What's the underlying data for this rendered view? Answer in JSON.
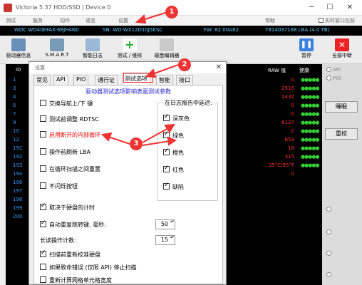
{
  "window": {
    "title": "Victoria 5.37 HDD/SSD | Device 0",
    "min": "─",
    "max": "☐",
    "close": "✕"
  },
  "menu": {
    "items": [
      "测试",
      "服务",
      "动作",
      "语言",
      "设置",
      "帮助"
    ],
    "realtime_label": "实时窗口在前"
  },
  "info": {
    "model": "WDC WD40EFAX-68JH4N0",
    "serial": "SN: WD-WX12D10J5KSC",
    "fw": "FW: 82.00A82",
    "lba": "7814037168 LBA (4.0 TB)"
  },
  "toolbar": {
    "drive_info": "驱动器信息",
    "smart": "S.M.A.R.T",
    "smart_log": "智能日志",
    "test_repair": "测试 / 维修",
    "disk_editor": "磁盘编辑器",
    "pause": "暂停",
    "stop": "全部中断"
  },
  "grid": {
    "col_id": "ID",
    "col_raw": "RAW 值",
    "col_health": "健康",
    "row_ids": [
      "1",
      "3",
      "4",
      "5",
      "7",
      "9",
      "10",
      "12",
      "191",
      "192",
      "193",
      "194",
      "196",
      "197",
      "198",
      "199",
      "200"
    ],
    "raw_values": [
      "0",
      "2516",
      "2432",
      "0",
      "0",
      "6127",
      "0",
      "653",
      "16",
      "315",
      "35°C/95°F",
      "0",
      "",
      "",
      "",
      "",
      ""
    ],
    "health": "●●●●●"
  },
  "right_panel": {
    "api": "API",
    "pio": "PIO",
    "sleep": "睡眠",
    "recalibrate": "重校"
  },
  "dialog": {
    "title": "设置",
    "close": "✕",
    "tabs": [
      "常见",
      "API",
      "PIO",
      "通行证",
      "测试选项",
      "智能",
      "接口"
    ],
    "subtitle": "驱动器测试选项影响表面测试参数",
    "options": {
      "nav_keys": "交换导航上/下 键",
      "rdtsc": "测试前调整 RDTSC",
      "internal_loop": "启用断开的内部循环",
      "flush_lba": "操作前刷新 LBA",
      "reset_between_loops": "在循环扫描之间重置",
      "no_blink": "不闪烁按钮",
      "hdd_timer": "取决于硬盘的计时",
      "auto_retry": "自动重复跳转键, 毫秒:",
      "long_op_count": "长读操作计数:",
      "calibrate_before": "扫描前重新校准硬盘",
      "fatal_error": "如果致命错误 (仅限 API) 停止扫描",
      "recalc_grid": "重新计算网格单元格宽度"
    },
    "spin_retry": "50",
    "spin_count": "15",
    "log_group": {
      "title": "在日志报告中延迟:",
      "items": [
        "深灰色",
        "绿色",
        "橙色",
        "红色",
        "缺陷"
      ]
    }
  },
  "annotations": [
    "1",
    "2",
    "3"
  ],
  "colors": {
    "accent_red": "#ee3333",
    "grid_bg": "#000000",
    "raw_red": "#ff3333",
    "health_green": "#33cc33",
    "subtitle_blue": "#2222cc"
  }
}
